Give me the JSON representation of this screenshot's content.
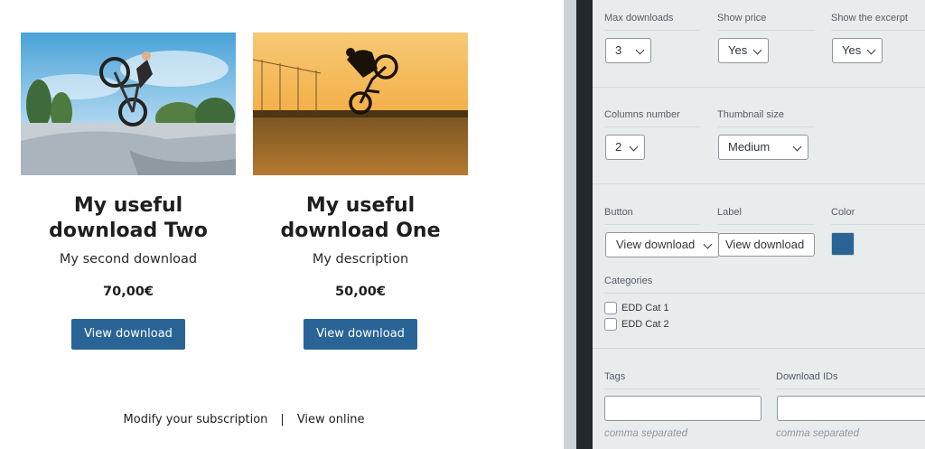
{
  "preview": {
    "cards": [
      {
        "title": "My useful download Two",
        "description": "My second download",
        "price": "70,00€",
        "button": "View download"
      },
      {
        "title": "My useful download One",
        "description": "My description",
        "price": "50,00€",
        "button": "View download"
      }
    ],
    "footer": {
      "modify": "Modify your subscription",
      "separator": "|",
      "view_online": "View online"
    }
  },
  "settings": {
    "max_downloads": {
      "label": "Max downloads",
      "value": "3"
    },
    "show_price": {
      "label": "Show price",
      "value": "Yes"
    },
    "show_excerpt": {
      "label": "Show the excerpt",
      "value": "Yes"
    },
    "columns_number": {
      "label": "Columns number",
      "value": "2"
    },
    "thumbnail_size": {
      "label": "Thumbnail size",
      "value": "Medium"
    },
    "button": {
      "label": "Button",
      "value": "View download"
    },
    "button_label": {
      "label": "Label",
      "value": "View download"
    },
    "color": {
      "label": "Color",
      "value": "#2a6496"
    },
    "categories": {
      "label": "Categories",
      "items": [
        "EDD Cat 1",
        "EDD Cat 2"
      ]
    },
    "tags": {
      "label": "Tags",
      "hint": "comma separated",
      "value": ""
    },
    "download_ids": {
      "label": "Download IDs",
      "hint": "comma separated",
      "value": ""
    }
  },
  "colors": {
    "button": "#2a6496",
    "sidebar_dark": "#23282d",
    "panel_bg": "#e9eced"
  }
}
